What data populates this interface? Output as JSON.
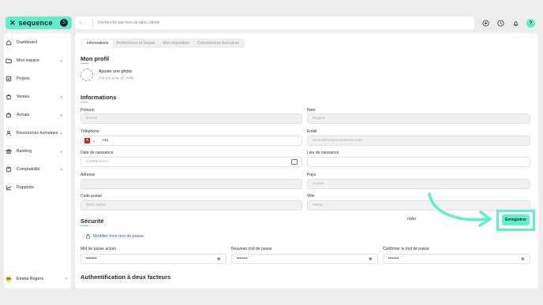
{
  "brand": {
    "name": "sequence",
    "badge": "S"
  },
  "sidebar": {
    "items": [
      {
        "label": "Dashboard",
        "icon": "home-icon",
        "chevron": false
      },
      {
        "label": "Mon espace",
        "icon": "folder-user-icon",
        "chevron": true
      },
      {
        "label": "Projets",
        "icon": "check-square-icon",
        "chevron": false
      },
      {
        "label": "Ventes",
        "icon": "sales-icon",
        "chevron": true
      },
      {
        "label": "Achats",
        "icon": "bag-icon",
        "chevron": true
      },
      {
        "label": "Ressources humaines",
        "icon": "people-icon",
        "chevron": true
      },
      {
        "label": "Banking",
        "icon": "bank-icon",
        "chevron": true
      },
      {
        "label": "Comptabilité",
        "icon": "calculator-icon",
        "chevron": true
      },
      {
        "label": "Rapports",
        "icon": "chart-line-icon",
        "chevron": false
      }
    ],
    "user": {
      "initials": "ER",
      "name": "Emma Rogers"
    }
  },
  "topbar": {
    "search_scope": "Q",
    "search_placeholder": "Recherche par mot-clé dans clients",
    "help_label": "?"
  },
  "tabs": [
    {
      "label": "Informations",
      "active": true
    },
    {
      "label": "Préférences et langue",
      "active": false
    },
    {
      "label": "Mon imposition",
      "active": false
    },
    {
      "label": "Coordonnées bancaires",
      "active": false
    }
  ],
  "profile": {
    "title": "Mon profil",
    "photo_label": "Ajouter une photo",
    "photo_hint": "png, jpg, jpeg, gif, webp"
  },
  "informations": {
    "title": "Informations",
    "prenom": {
      "label": "Prénom",
      "value": "Emma"
    },
    "nom": {
      "label": "Nom",
      "value": "Rogers"
    },
    "telephone": {
      "label": "Téléphone",
      "prefix": "+41",
      "flag": "+"
    },
    "email": {
      "label": "Email",
      "value": "emma@easyinnovations.com"
    },
    "naissance": {
      "label": "Date de naissance",
      "placeholder": "JJ/MM/AAAA"
    },
    "lieu": {
      "label": "Lieu de naissance",
      "value": ""
    },
    "adresse": {
      "label": "Adresse",
      "value": ""
    },
    "pays": {
      "label": "Pays",
      "value": "Suisse"
    },
    "code_postal": {
      "label": "Code postal",
      "value": "5000 Aarau"
    },
    "ville": {
      "label": "Ville",
      "value": "Aarau"
    }
  },
  "securite": {
    "title": "Sécurité",
    "change_password": "Modifier mon mot de passe",
    "current": {
      "label": "Mot de passe actuel",
      "value": "••••••••"
    },
    "new": {
      "label": "Nouveau mot de passe",
      "value": "••••••••"
    },
    "confirm": {
      "label": "Confirmer le mot de passe",
      "value": "••••••••"
    }
  },
  "actions": {
    "cancel": "nuler",
    "save": "Enregistrer"
  },
  "twofa": {
    "title": "Authentification à deux facteurs"
  },
  "colors": {
    "accent": "#5ef0c8",
    "dark": "#14222b",
    "link": "#3b5bd1"
  }
}
